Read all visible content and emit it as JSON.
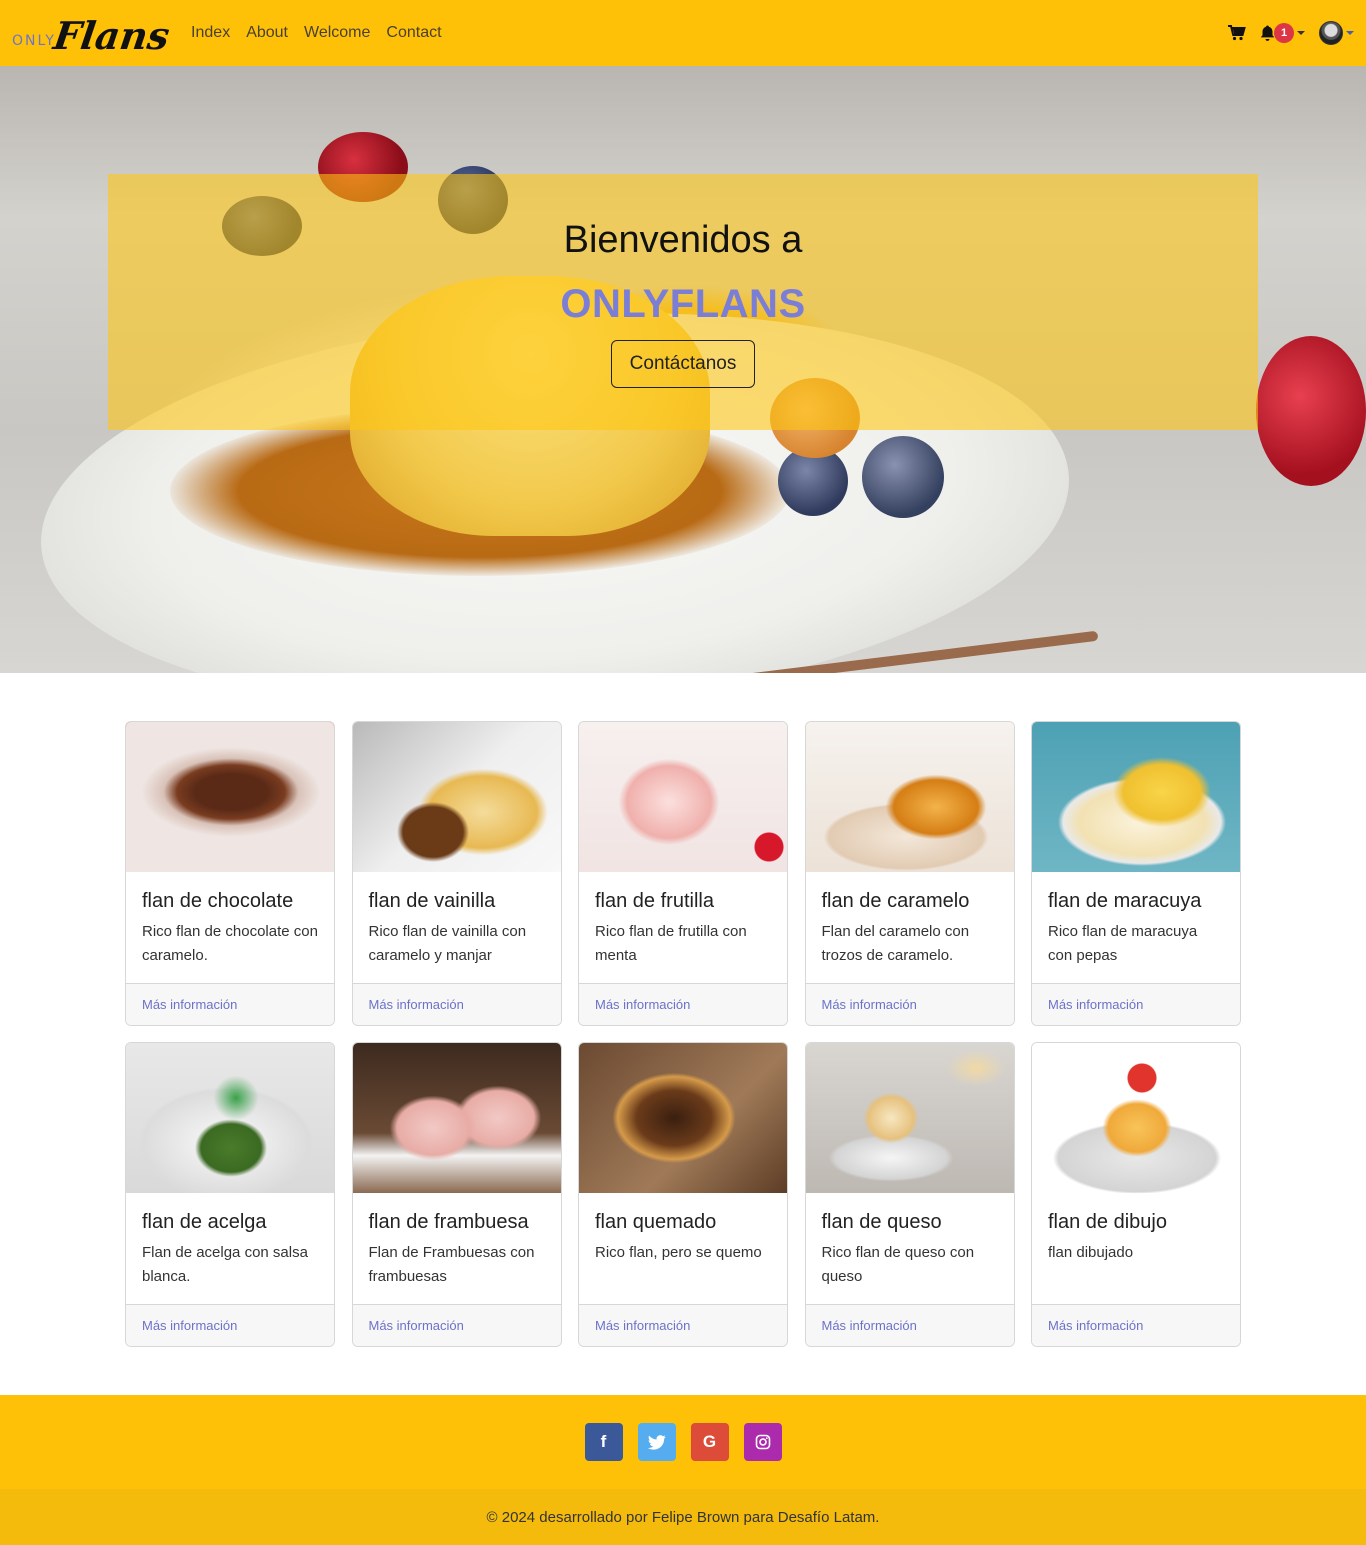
{
  "nav": {
    "brand_top": "ONLY",
    "brand_script": "Flans",
    "links": [
      {
        "label": "Index"
      },
      {
        "label": "About"
      },
      {
        "label": "Welcome"
      },
      {
        "label": "Contact"
      }
    ],
    "notification_count": "1",
    "icons": {
      "cart": "cart-icon",
      "bell": "bell-icon",
      "avatar": "user-avatar"
    }
  },
  "hero": {
    "title": "Bienvenidos a",
    "brand": "ONLYFLANS",
    "button": "Contáctanos"
  },
  "cards": [
    {
      "title": "flan de chocolate",
      "text": "Rico flan de chocolate con caramelo.",
      "link": "Más información"
    },
    {
      "title": "flan de vainilla",
      "text": "Rico flan de vainilla con caramelo y manjar",
      "link": "Más información"
    },
    {
      "title": "flan de frutilla",
      "text": "Rico flan de frutilla con menta",
      "link": "Más información"
    },
    {
      "title": "flan de caramelo",
      "text": "Flan del caramelo con trozos de caramelo.",
      "link": "Más información"
    },
    {
      "title": "flan de maracuya",
      "text": "Rico flan de maracuya con pepas",
      "link": "Más información"
    },
    {
      "title": "flan de acelga",
      "text": "Flan de acelga con salsa blanca.",
      "link": "Más información"
    },
    {
      "title": "flan de frambuesa",
      "text": "Flan de Frambuesas con frambuesas",
      "link": "Más información"
    },
    {
      "title": "flan quemado",
      "text": "Rico flan, pero se quemo",
      "link": "Más información"
    },
    {
      "title": "flan de queso",
      "text": "Rico flan de queso con queso",
      "link": "Más información"
    },
    {
      "title": "flan de dibujo",
      "text": "flan dibujado",
      "link": "Más información"
    }
  ],
  "footer": {
    "social": [
      {
        "icon": "facebook-icon",
        "glyph": "f"
      },
      {
        "icon": "twitter-icon",
        "glyph": "t"
      },
      {
        "icon": "google-icon",
        "glyph": "G"
      },
      {
        "icon": "instagram-icon",
        "glyph": "◎"
      }
    ],
    "copyright": "© 2024 desarrollado por Felipe Brown para Desafío Latam."
  },
  "colors": {
    "primary": "#ffc107",
    "brand_text": "#7b7ed6",
    "link": "#6c72c8"
  }
}
